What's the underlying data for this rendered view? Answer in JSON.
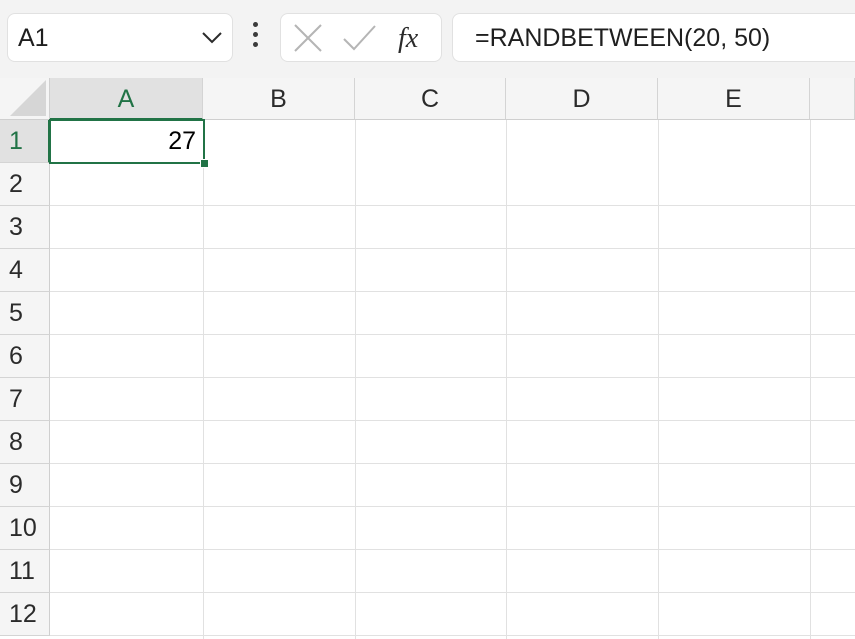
{
  "formula_bar": {
    "name_box": "A1",
    "formula": "=RANDBETWEEN(20, 50)",
    "cancel_icon": "close-icon",
    "enter_icon": "checkmark-icon",
    "function_icon": "fx-icon",
    "function_label": "fx"
  },
  "grid": {
    "columns": [
      "A",
      "B",
      "C",
      "D",
      "E"
    ],
    "rows": [
      "1",
      "2",
      "3",
      "4",
      "5",
      "6",
      "7",
      "8",
      "9",
      "10",
      "11",
      "12"
    ],
    "active_cell": "A1",
    "cells": {
      "A1": "27"
    }
  },
  "colors": {
    "accent": "#217346",
    "header_bg": "#f5f5f5",
    "gridline": "#e1e1e1"
  }
}
